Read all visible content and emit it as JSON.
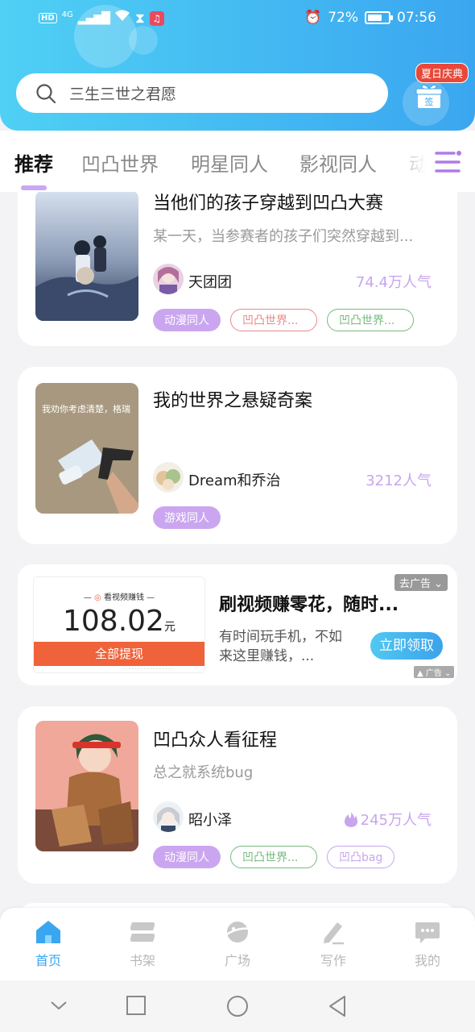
{
  "status_bar": {
    "hd": "HD",
    "network": "4G",
    "battery": "72%",
    "battery_level": 0.72,
    "time": "07:56"
  },
  "search": {
    "placeholder": "三生三世之君愿"
  },
  "signin": {
    "badge": "夏日庆典",
    "label": "签"
  },
  "tabs": [
    {
      "label": "推荐",
      "active": true
    },
    {
      "label": "凹凸世界"
    },
    {
      "label": "明星同人"
    },
    {
      "label": "影视同人"
    },
    {
      "label": "动"
    }
  ],
  "cards": [
    {
      "title": "当他们的孩子穿越到凹凸大赛",
      "desc": "某一天，当参赛者的孩子们突然穿越到...",
      "author": "天团团",
      "popularity": "74.4万人气",
      "tags": [
        "动漫同人",
        "凹凸世界...",
        "凹凸世界..."
      ]
    },
    {
      "title": "我的世界之悬疑奇案",
      "cover_text": "我劝你考虑清楚，格瑞",
      "author": "Dream和乔治",
      "popularity": "3212人气",
      "tags": [
        "游戏同人"
      ]
    },
    {
      "title": "凹凸众人看征程",
      "desc": "总之就系统bug",
      "author": "昭小泽",
      "popularity": "245万人气",
      "tags": [
        "动漫同人",
        "凹凸世界...",
        "凹凸bag"
      ]
    }
  ],
  "ad": {
    "image_header": "看视频赚钱",
    "amount": "108.02",
    "unit": "元",
    "cashout": "全部提现",
    "title": "刷视频赚零花，随时...",
    "desc": "有时间玩手机，不如来这里赚钱，...",
    "close_label": "去广告",
    "cta": "立即领取",
    "ad_label": "广告"
  },
  "bottom_nav": [
    {
      "label": "首页",
      "active": true
    },
    {
      "label": "书架"
    },
    {
      "label": "广场"
    },
    {
      "label": "写作"
    },
    {
      "label": "我的"
    }
  ],
  "colors": {
    "accent": "#3aa6f0",
    "tag_fill": "#cba6f0",
    "popularity": "#c8a5ee",
    "ad_red": "#f0623a"
  }
}
